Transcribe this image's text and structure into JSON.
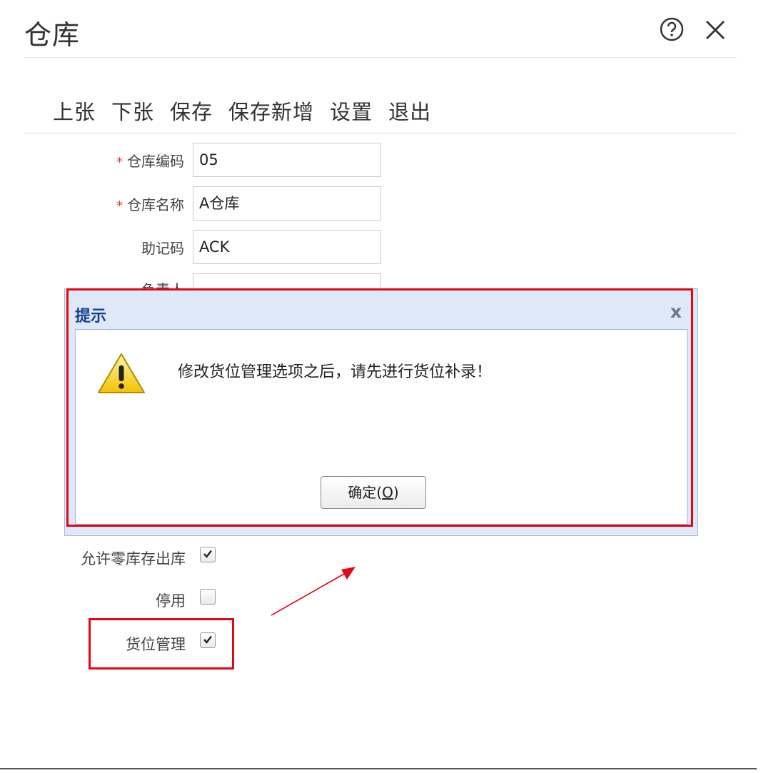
{
  "window": {
    "title": "仓库"
  },
  "toolbar": {
    "buttons": [
      "上张",
      "下张",
      "保存",
      "保存新增",
      "设置",
      "退出"
    ]
  },
  "form": {
    "fields": [
      {
        "label": "仓库编码",
        "required": true,
        "value": "05"
      },
      {
        "label": "仓库名称",
        "required": true,
        "value": "A仓库"
      },
      {
        "label": "助记码",
        "required": false,
        "value": "ACK"
      },
      {
        "label": "负责人",
        "required": false,
        "value": ""
      }
    ],
    "required_mark": "*",
    "checkboxes": [
      {
        "label": "允许零库存出库",
        "checked": true
      },
      {
        "label": "停用",
        "checked": false
      },
      {
        "label": "货位管理",
        "checked": true
      }
    ]
  },
  "dialog": {
    "title": "提示",
    "close_glyph": "x",
    "icon": "warning-icon",
    "message": "修改货位管理选项之后，请先进行货位补录！",
    "ok_label_main": "确定(",
    "ok_label_key": "O",
    "ok_label_end": ")"
  },
  "colors": {
    "highlight": "#e30613",
    "dialog_header": "#dfe8f6",
    "dialog_border": "#99bbe8"
  }
}
